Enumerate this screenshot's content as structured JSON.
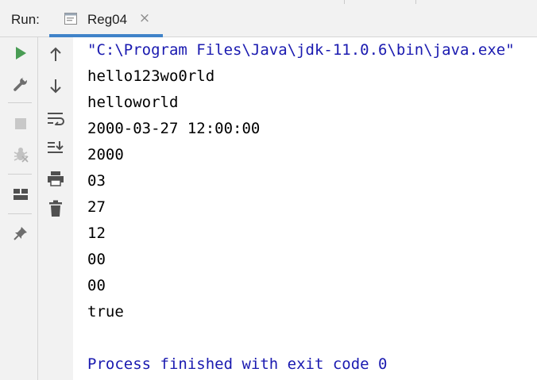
{
  "colors": {
    "accent_underline": "#4083c9",
    "run_green": "#499c54",
    "console_blue": "#1a1ab0",
    "icon_gray": "#6e6e6e",
    "disabled_gray": "#b8b8b8",
    "toolbar_bg": "#f2f2f2"
  },
  "run_panel": {
    "label": "Run:",
    "tab": {
      "label": "Reg04",
      "icon": "console-window-icon",
      "close_glyph": "×"
    }
  },
  "toolbar_left": [
    {
      "name": "run-icon",
      "enabled": true
    },
    {
      "name": "wrench-icon",
      "enabled": true
    },
    {
      "name": "stop-icon",
      "enabled": false
    },
    {
      "name": "debug-disabled-icon",
      "enabled": false
    },
    {
      "name": "layout-icon",
      "enabled": true
    },
    {
      "name": "pin-icon",
      "enabled": true
    }
  ],
  "toolbar_right": [
    {
      "name": "arrow-up-icon"
    },
    {
      "name": "arrow-down-icon"
    },
    {
      "name": "soft-wrap-icon"
    },
    {
      "name": "scroll-to-end-icon"
    },
    {
      "name": "print-icon"
    },
    {
      "name": "trash-icon"
    }
  ],
  "console": {
    "command_line": "\"C:\\Program Files\\Java\\jdk-11.0.6\\bin\\java.exe\"",
    "output_lines": [
      "hello123wo0rld",
      "helloworld",
      "2000-03-27 12:00:00",
      "2000",
      "03",
      "27",
      "12",
      "00",
      "00",
      "true"
    ],
    "exit_message": "Process finished with exit code 0"
  }
}
